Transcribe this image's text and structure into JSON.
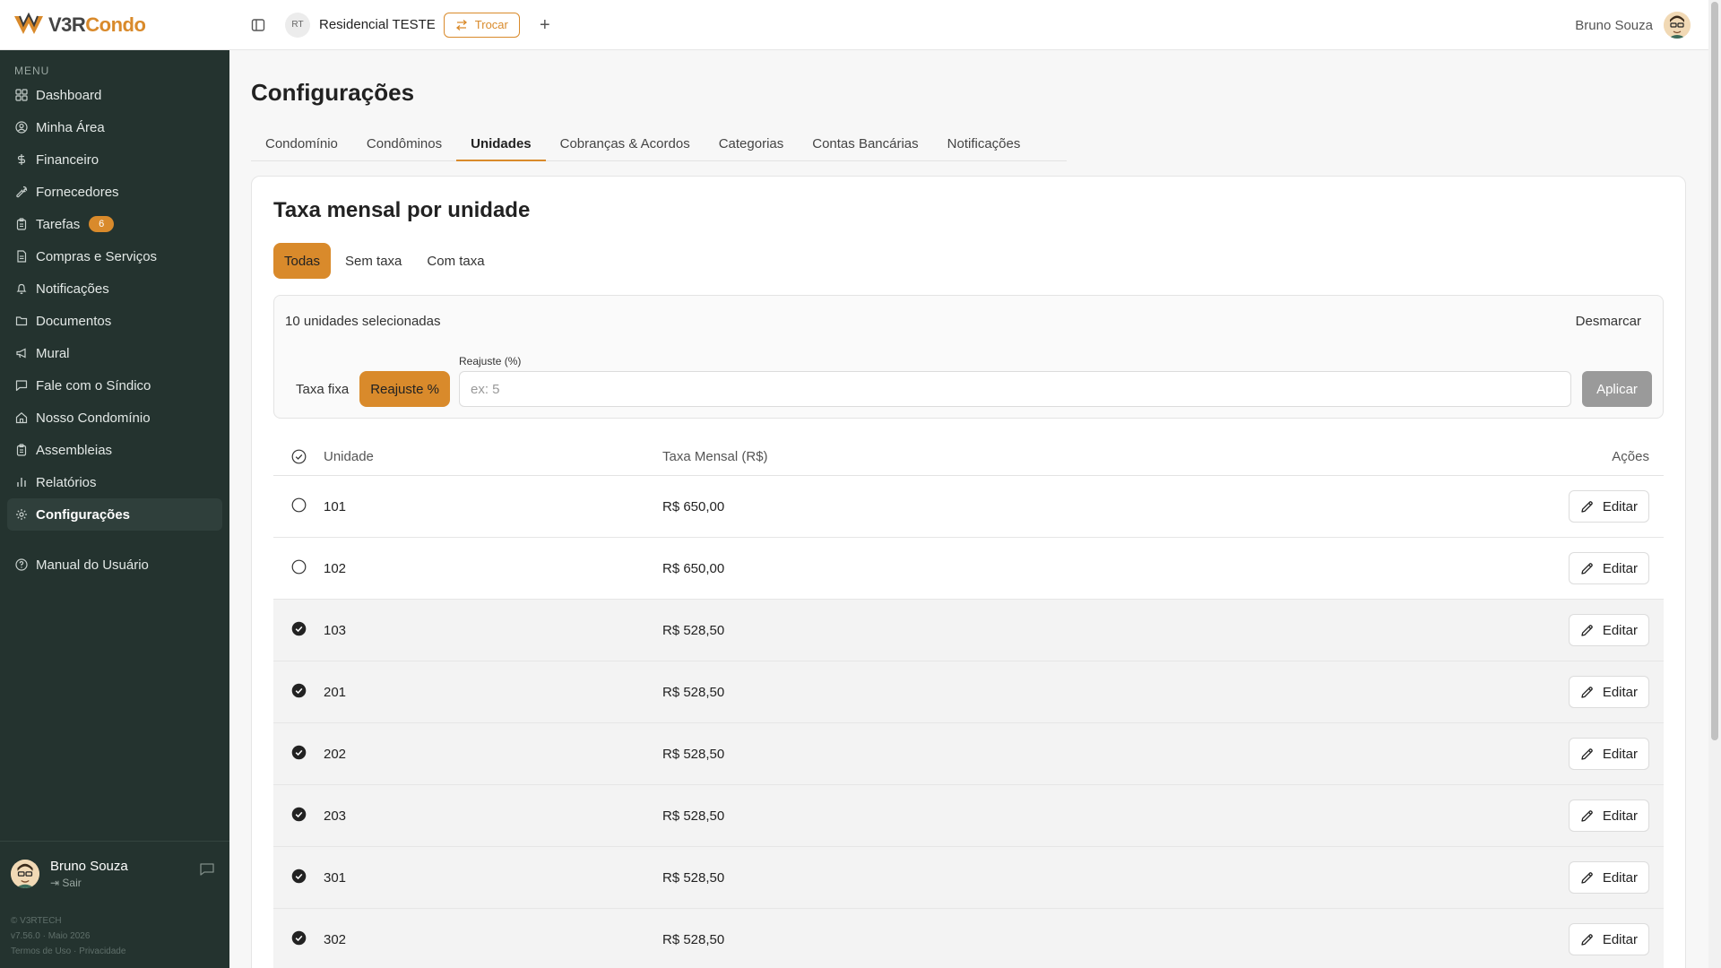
{
  "brand": {
    "v3r": "V3R",
    "condo": "Condo"
  },
  "header": {
    "condo_initials": "RT",
    "condo_name": "Residencial TESTE",
    "switch_label": "Trocar",
    "add_label": "+",
    "user_name": "Bruno Souza"
  },
  "sidebar": {
    "menu_title": "MENU",
    "items": [
      {
        "label": "Dashboard",
        "icon": "grid-icon"
      },
      {
        "label": "Minha Área",
        "icon": "user-circle-icon"
      },
      {
        "label": "Financeiro",
        "icon": "dollar-icon"
      },
      {
        "label": "Fornecedores",
        "icon": "wrench-icon"
      },
      {
        "label": "Tarefas",
        "icon": "clipboard-icon",
        "badge": "6"
      },
      {
        "label": "Compras e Serviços",
        "icon": "document-icon"
      },
      {
        "label": "Notificações",
        "icon": "bell-icon"
      },
      {
        "label": "Documentos",
        "icon": "folder-icon"
      },
      {
        "label": "Mural",
        "icon": "megaphone-icon"
      },
      {
        "label": "Fale com o Síndico",
        "icon": "chat-icon"
      },
      {
        "label": "Nosso Condomínio",
        "icon": "home-icon"
      },
      {
        "label": "Assembleias",
        "icon": "clipboard-icon"
      },
      {
        "label": "Relatórios",
        "icon": "bar-chart-icon"
      },
      {
        "label": "Configurações",
        "icon": "gear-icon",
        "active": true
      }
    ],
    "manual_label": "Manual do Usuário",
    "user_name": "Bruno Souza",
    "logout_label": "Sair",
    "footer_company": "© V3RTECH",
    "footer_version": "v7.56.0 · Maio 2026",
    "footer_terms": "Termos de Uso",
    "footer_sep": "·",
    "footer_privacy": "Privacidade"
  },
  "page": {
    "title": "Configurações",
    "tabs": [
      {
        "label": "Condomínio"
      },
      {
        "label": "Condôminos"
      },
      {
        "label": "Unidades",
        "active": true
      },
      {
        "label": "Cobranças & Acordos"
      },
      {
        "label": "Categorias"
      },
      {
        "label": "Contas Bancárias"
      },
      {
        "label": "Notificações"
      }
    ]
  },
  "card": {
    "title": "Taxa mensal por unidade",
    "filters": [
      {
        "label": "Todas",
        "active": true
      },
      {
        "label": "Sem taxa"
      },
      {
        "label": "Com taxa"
      }
    ],
    "bulk": {
      "count_text": "10 unidades selecionadas",
      "clear_label": "Desmarcar",
      "mode_fixed": "Taxa fixa",
      "mode_percent": "Reajuste %",
      "input_label": "Reajuste (%)",
      "input_placeholder": "ex: 5",
      "input_value": "",
      "apply_label": "Aplicar"
    },
    "table": {
      "headers": {
        "unit": "Unidade",
        "fee": "Taxa Mensal (R$)",
        "actions": "Ações"
      },
      "edit_label": "Editar",
      "rows": [
        {
          "unit": "101",
          "fee": "R$ 650,00",
          "selected": false
        },
        {
          "unit": "102",
          "fee": "R$ 650,00",
          "selected": false
        },
        {
          "unit": "103",
          "fee": "R$ 528,50",
          "selected": true
        },
        {
          "unit": "201",
          "fee": "R$ 528,50",
          "selected": true
        },
        {
          "unit": "202",
          "fee": "R$ 528,50",
          "selected": true
        },
        {
          "unit": "203",
          "fee": "R$ 528,50",
          "selected": true
        },
        {
          "unit": "301",
          "fee": "R$ 528,50",
          "selected": true
        },
        {
          "unit": "302",
          "fee": "R$ 528,50",
          "selected": true
        }
      ]
    }
  },
  "colors": {
    "accent": "#d98a2b",
    "sidebar_bg": "#24332f"
  }
}
